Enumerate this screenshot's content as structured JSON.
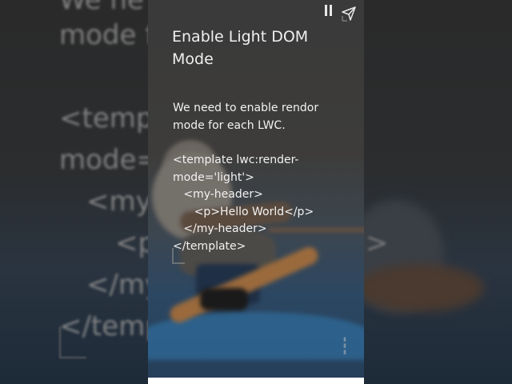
{
  "story": {
    "title": "Enable Light DOM Mode",
    "description": "We need to enable rendor mode for each LWC.",
    "code_lines": [
      "<template lwc:render-",
      "mode='light'>",
      "   <my-header>",
      "      <p>Hello World</p>",
      "   </my-header>",
      "</template>"
    ],
    "controls": {
      "pause_icon": "pause-icon",
      "share_icon": "send-icon"
    }
  },
  "background": {
    "left_lines": [
      "We ne",
      "mode f",
      "<templ",
      "mode=",
      "<my-",
      "<p",
      "</my",
      "</temp"
    ],
    "right_lines": [
      ">"
    ]
  },
  "colors": {
    "text": "#f2f2f2",
    "panel_top": "#3a3a3a",
    "panel_bottom": "#263f5a"
  }
}
